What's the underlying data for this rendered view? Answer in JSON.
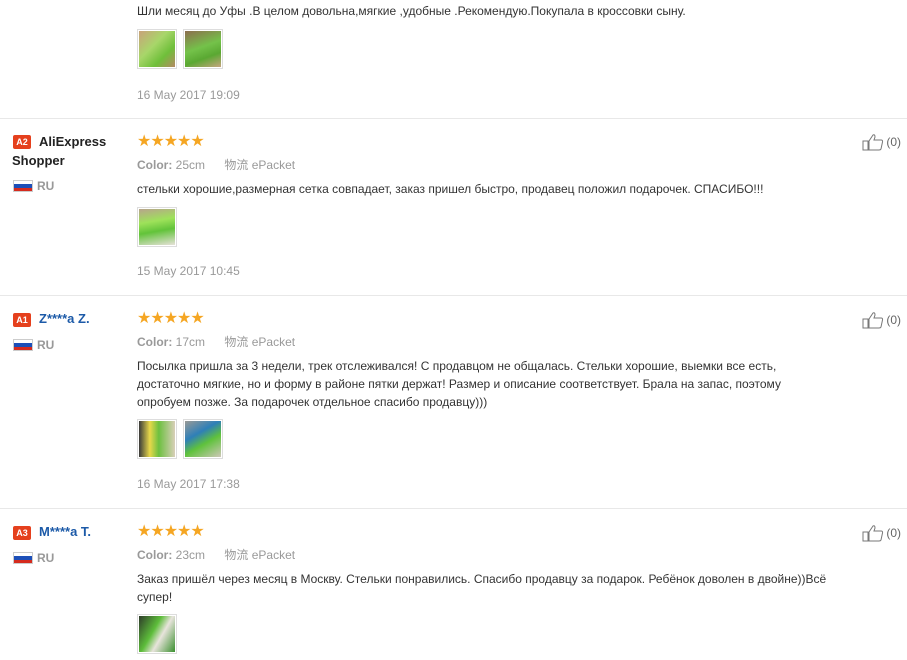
{
  "top_review": {
    "text": "Шли месяц до Уфы .В целом довольна,мягкие ,удобные .Рекомендую.Покупала в кроссовки сыну.",
    "date": "16 May 2017 19:09",
    "photos": [
      "photo-insole-green-1",
      "photo-insole-green-2"
    ]
  },
  "reviews": [
    {
      "badge": "A2",
      "name_line1": "AliExpress",
      "name_line2": "Shopper",
      "country": "RU",
      "stars": "★★★★★",
      "color_label": "Color:",
      "color_value": "25cm",
      "ship_label": "物流",
      "ship_value": "ePacket",
      "text": "стельки хорошие,размерная сетка совпадает, заказ пришел быстро, продавец положил подарочек. СПАСИБО!!!",
      "date": "15 May 2017 10:45",
      "helpful": "(0)"
    },
    {
      "badge": "A1",
      "name": "Z****a Z.",
      "country": "RU",
      "stars": "★★★★★",
      "color_label": "Color:",
      "color_value": "17cm",
      "ship_label": "物流",
      "ship_value": "ePacket",
      "text_lines": [
        "Посылка пришла за 3 недели, трек отслеживался! С продавцом не общалась. Стельки хорошие, выемки все есть,",
        "достаточно мягкие, но и форму в районе пятки держат! Размер и описание соответствует. Брала на запас, поэтому",
        "опробуем позже. За подарочек отдельное спасибо продавцу)))"
      ],
      "date": "16 May 2017 17:38",
      "helpful": "(0)"
    },
    {
      "badge": "A3",
      "name": "M****a T.",
      "country": "RU",
      "stars": "★★★★★",
      "color_label": "Color:",
      "color_value": "23cm",
      "ship_label": "物流",
      "ship_value": "ePacket",
      "text_lines": [
        "Заказ пришёл через месяц в Москву. Стельки понравились. Спасибо продавцу за подарок. Ребёнок доволен в двойне))Всё",
        "супер!"
      ],
      "helpful": "(0)"
    }
  ],
  "colors": {
    "accent": "#e5401d",
    "star": "#f5a623",
    "link": "#1c5aa8"
  }
}
